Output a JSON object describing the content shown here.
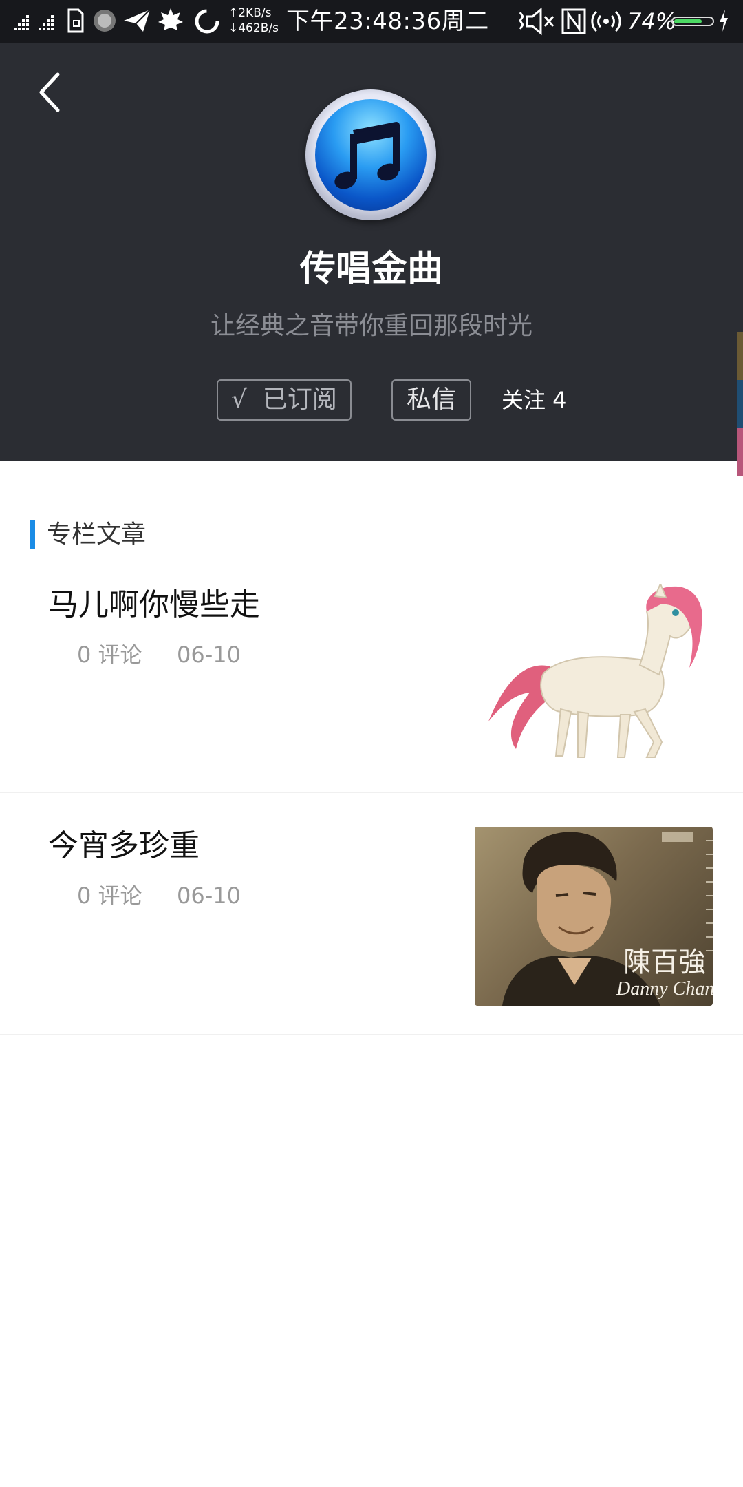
{
  "status_bar": {
    "upload_speed": "↑2KB/s",
    "download_speed": "↓462B/s",
    "time": "下午23:48:36周二",
    "battery": "74%",
    "battery_level": 0.74
  },
  "header": {
    "title": "传唱金曲",
    "subtitle": "让经典之音带你重回那段时光",
    "subscribed_label": "√  已订阅",
    "message_label": "私信",
    "follow_label": "关注 4",
    "background_color": "#2b2d33"
  },
  "section": {
    "title": "专栏文章",
    "accent_color": "#1a8ce6"
  },
  "articles": [
    {
      "title": "马儿啊你慢些走",
      "comments": "0 评论",
      "date": "06-10"
    },
    {
      "title": "今宵多珍重",
      "comments": "0 评论",
      "date": "06-10",
      "cover_text_cn": "陳百強",
      "cover_text_en": "Danny Chan"
    }
  ]
}
